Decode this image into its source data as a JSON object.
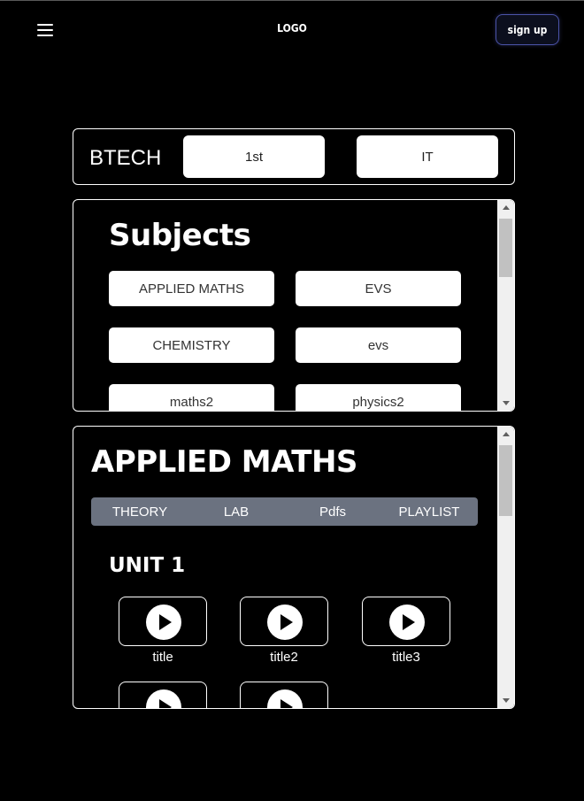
{
  "header": {
    "logo": "LOGO",
    "signup_label": "sign up"
  },
  "course": {
    "label": "BTECH",
    "year": "1st",
    "branch": "IT"
  },
  "subjects": {
    "title": "Subjects",
    "items": [
      "APPLIED MATHS",
      "EVS",
      "CHEMISTRY",
      "evs",
      "maths2",
      "physics2"
    ]
  },
  "detail": {
    "title": "APPLIED MATHS",
    "tabs": [
      "THEORY",
      "LAB",
      "Pdfs",
      "PLAYLIST"
    ],
    "unit_title": "UNIT 1",
    "videos": [
      "title",
      "title2",
      "title3",
      "",
      ""
    ]
  },
  "colors": {
    "background": "#000000",
    "tab_bar": "#6b7280",
    "signup_border": "#4b53a8"
  }
}
